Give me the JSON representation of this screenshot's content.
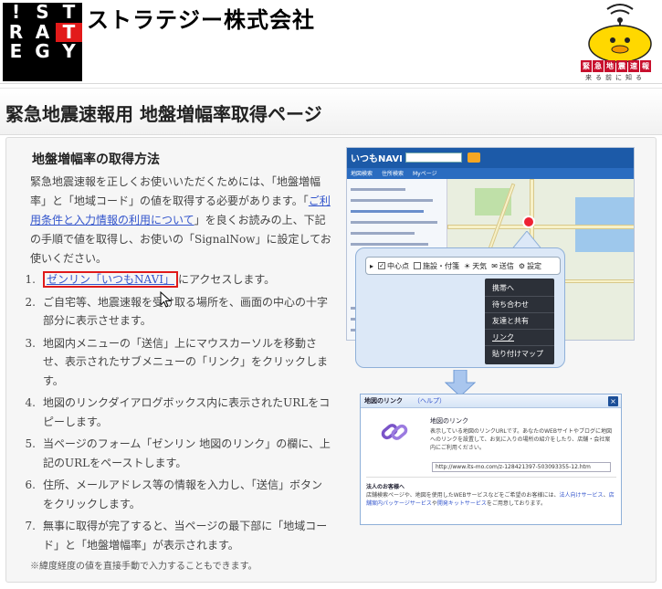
{
  "header": {
    "logo_letters": [
      "!",
      "S",
      "T",
      "R",
      "A",
      "T",
      "E",
      "G",
      "Y",
      "",
      "",
      ""
    ],
    "logo_red_index": 5,
    "company_name": "ストラテジー株式会社",
    "mascot_badge": [
      "緊",
      "急",
      "地",
      "震",
      "速",
      "報"
    ],
    "mascot_tagline": "来る前に知る"
  },
  "page": {
    "title": "緊急地震速報用 地盤増幅率取得ページ"
  },
  "content": {
    "section_heading": "地盤増幅率の取得方法",
    "intro_before": "緊急地震速報を正しくお使いいただくためには、「地盤増幅率」と「地域コード」の値を取得する必要があります。「",
    "intro_link": "ご利用条件と入力情報の利用について",
    "intro_after": "」を良くお読みの上、下記の手順で値を取得し、お使いの「SignalNow」に設定してお使いください。",
    "steps": [
      {
        "num": "1.",
        "link": "ゼンリン「いつもNAVI」",
        "text": "にアクセスします。"
      },
      {
        "num": "2.",
        "text": "ご自宅等、地震速報を受け取る場所を、画面の中心の十字部分に表示させます。"
      },
      {
        "num": "3.",
        "text": "地図内メニューの「送信」上にマウスカーソルを移動させ、表示されたサブメニューの「リンク」をクリックします。"
      },
      {
        "num": "4.",
        "text": "地図のリンクダイアログボックス内に表示されたURLをコピーします。"
      },
      {
        "num": "5.",
        "text": "当ページのフォーム「ゼンリン 地図のリンク」の欄に、上記のURLをペーストします。"
      },
      {
        "num": "6.",
        "text": "住所、メールアドレス等の情報を入力し、「送信」ボタンをクリックします。"
      },
      {
        "num": "7.",
        "text": "無事に取得が完了すると、当ページの最下部に「地域コード」と「地盤増幅率」が表示されます。"
      }
    ],
    "note": "※緯度経度の値を直接手動で入力することもできます。"
  },
  "screenshot": {
    "map_brand": "いつもNAVI",
    "map_tabs": [
      "地図検索",
      "住所検索",
      "Myページ"
    ],
    "toolbar": {
      "center": "中心点",
      "facility": "施設・付箋",
      "weather": "天気",
      "send": "送信",
      "settings": "設定"
    },
    "submenu": [
      "携帯へ",
      "待ち合わせ",
      "友達と共有",
      "リンク",
      "貼り付けマップ"
    ],
    "dialog": {
      "title": "地図のリンク",
      "help": "（ヘルプ）",
      "close": "×",
      "subtitle": "地図のリンク",
      "desc": "表示している地図のリンクURLです。あなたのWEBサイトやブログに地図へのリンクを設置して、お気に入りの場所の紹介をしたり、店舗・会社案内にご利用ください。",
      "url": "http://www.its-mo.com/z-128421397-503093355-12.htm",
      "foot_title": "法人のお客様へ",
      "foot_before": "店舗検索ページや、地図を使用したWEBサービスなどをご希望のお客様には、",
      "foot_link1": "法人向けサービス",
      "foot_mid": "、",
      "foot_link2": "店舗案内パッケージサービス",
      "foot_mid2": "や",
      "foot_link3": "開発キットサービス",
      "foot_after": "をご用意しております。"
    }
  }
}
